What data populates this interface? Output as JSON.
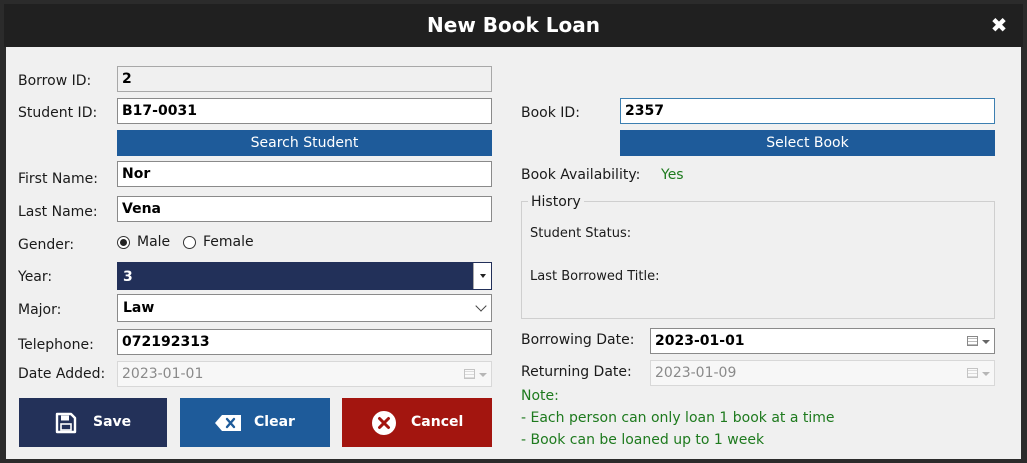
{
  "window": {
    "title": "New Book Loan",
    "close_glyph": "✖"
  },
  "form": {
    "borrow_id": {
      "label": "Borrow ID:",
      "value": "2"
    },
    "student_id": {
      "label": "Student ID:",
      "value": "B17-0031"
    },
    "search_student_label": "Search Student",
    "first_name": {
      "label": "First Name:",
      "value": "Nor"
    },
    "last_name": {
      "label": "Last Name:",
      "value": "Vena"
    },
    "gender": {
      "label": "Gender:",
      "options": [
        "Male",
        "Female"
      ],
      "selected": "Male"
    },
    "year": {
      "label": "Year:",
      "value": "3"
    },
    "major": {
      "label": "Major:",
      "value": "Law"
    },
    "telephone": {
      "label": "Telephone:",
      "value": "072192313"
    },
    "date_added": {
      "label": "Date Added:",
      "value": "2023-01-01"
    },
    "book_id": {
      "label": "Book ID:",
      "value": "2357"
    },
    "select_book_label": "Select Book",
    "book_availability": {
      "label": "Book Availability:",
      "value": "Yes"
    },
    "history": {
      "title": "History",
      "student_status_label": "Student Status:",
      "last_borrowed_label": "Last Borrowed Title:"
    },
    "borrowing_date": {
      "label": "Borrowing Date:",
      "value": "2023-01-01"
    },
    "returning_date": {
      "label": "Returning Date:",
      "value": "2023-01-09"
    },
    "notes": {
      "title": "Note:",
      "lines": [
        "- Each person can only loan 1 book at a time",
        "- Book can be loaned up to 1 week"
      ]
    }
  },
  "actions": {
    "save_label": "Save",
    "clear_label": "Clear",
    "cancel_label": "Cancel"
  },
  "colors": {
    "save": "#233159",
    "clear": "#1e5b9a",
    "cancel": "#a3150f",
    "accent_button": "#1e5b9a",
    "availability_text": "#1e7a1e",
    "title_bar": "#202020"
  },
  "icons": {
    "close": "close-icon",
    "save": "floppy-disk-icon",
    "clear": "backspace-icon",
    "cancel": "x-circle-icon",
    "calendar": "calendar-icon",
    "dropdown": "chevron-down-icon"
  }
}
